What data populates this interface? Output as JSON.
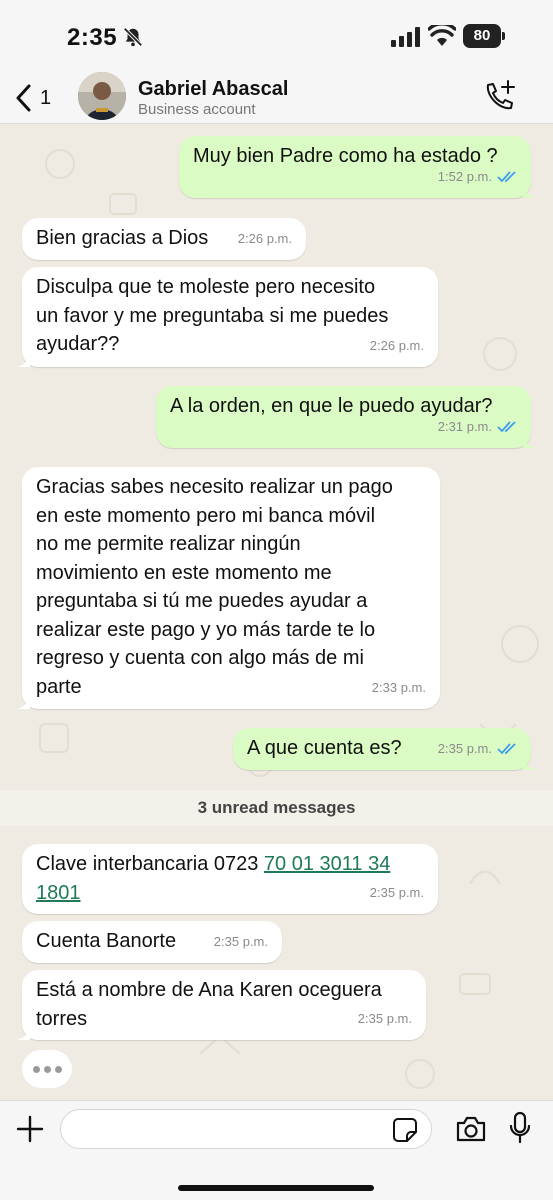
{
  "status_bar": {
    "time": "2:35",
    "battery": "80"
  },
  "header": {
    "back_count": "1",
    "contact_name": "Gabriel Abascal",
    "contact_subtitle": "Business account"
  },
  "messages": [
    {
      "direction": "out",
      "lines": [
        "Muy bien Padre como ha estado ?"
      ],
      "time": "1:52 p.m.",
      "read": true
    },
    {
      "direction": "in",
      "lines": [
        "Bien gracias a Dios"
      ],
      "time": "2:26 p.m."
    },
    {
      "direction": "in",
      "lines": [
        "Disculpa que te moleste pero necesito",
        "un favor y me preguntaba si me puedes",
        "ayudar??"
      ],
      "time": "2:26 p.m."
    },
    {
      "direction": "out",
      "lines": [
        "A la orden, en que le puedo ayudar?"
      ],
      "time": "2:31 p.m.",
      "read": true
    },
    {
      "direction": "in",
      "lines": [
        "Gracias sabes necesito realizar un pago",
        "en este momento pero mi banca móvil",
        "no me permite realizar ningún",
        "movimiento en este momento me",
        "preguntaba si tú me puedes ayudar a",
        "realizar este pago y yo más tarde te lo",
        "regreso y cuenta con algo más de mi",
        "parte"
      ],
      "time": "2:33 p.m."
    },
    {
      "direction": "out",
      "lines": [
        "A que cuenta es?"
      ],
      "time": "2:35 p.m.",
      "read": true
    },
    {
      "direction": "in",
      "text_prefix": "Clave interbancaria 0723 ",
      "link_line1": "70 01 3011 34",
      "link_line2": "1801",
      "time": "2:35 p.m."
    },
    {
      "direction": "in",
      "lines": [
        "Cuenta Banorte"
      ],
      "time": "2:35 p.m."
    },
    {
      "direction": "in",
      "lines": [
        "Está a nombre de Ana Karen oceguera",
        "torres"
      ],
      "time": "2:35 p.m."
    }
  ],
  "unread_label": "3 unread messages",
  "composer": {
    "placeholder": ""
  },
  "colors": {
    "chat_background": "#efeae2",
    "outgoing_bubble": "#dbfbc4",
    "incoming_bubble": "#ffffff",
    "read_ticks": "#3c9df0",
    "link": "#1f7a55"
  },
  "icons": [
    "bell-slash-icon",
    "signal-icon",
    "wifi-icon",
    "battery-icon",
    "chevron-left-icon",
    "phone-add-icon",
    "double-check-icon",
    "plus-icon",
    "sticker-icon",
    "camera-icon",
    "microphone-icon"
  ]
}
